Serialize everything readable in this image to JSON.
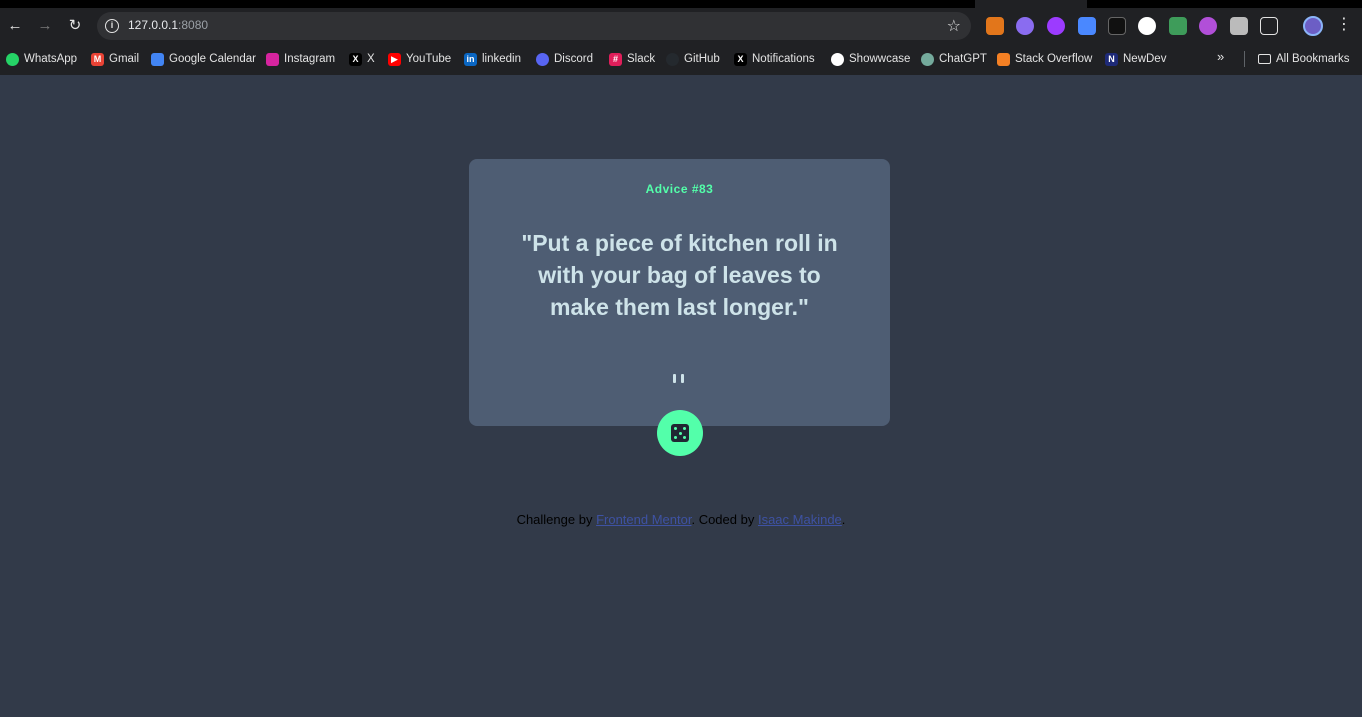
{
  "browser": {
    "url_host": "127.0.0.1",
    "url_port": ":8080",
    "bookmarks": [
      {
        "label": "WhatsApp",
        "icon": "whatsapp-icon",
        "color": "#25d366"
      },
      {
        "label": "Gmail",
        "icon": "gmail-icon",
        "color": "#ea4335"
      },
      {
        "label": "Google Calendar",
        "icon": "calendar-icon",
        "color": "#4285f4"
      },
      {
        "label": "Instagram",
        "icon": "instagram-icon",
        "color": "#d6249f"
      },
      {
        "label": "X",
        "icon": "x-icon",
        "color": "#000000"
      },
      {
        "label": "YouTube",
        "icon": "youtube-icon",
        "color": "#ff0000"
      },
      {
        "label": "linkedin",
        "icon": "linkedin-icon",
        "color": "#0a66c2"
      },
      {
        "label": "Discord",
        "icon": "discord-icon",
        "color": "#5865f2"
      },
      {
        "label": "Slack",
        "icon": "slack-icon",
        "color": "#e01e5a"
      },
      {
        "label": "GitHub",
        "icon": "github-icon",
        "color": "#24292e"
      },
      {
        "label": "Notifications",
        "icon": "x-icon",
        "color": "#000000"
      },
      {
        "label": "Showwcase",
        "icon": "showwcase-icon",
        "color": "#ffffff"
      },
      {
        "label": "ChatGPT",
        "icon": "chatgpt-icon",
        "color": "#74aa9c"
      },
      {
        "label": "Stack Overflow",
        "icon": "stackoverflow-icon",
        "color": "#f48024"
      },
      {
        "label": "NewDev",
        "icon": "newdev-icon",
        "color": "#1e2a78"
      }
    ],
    "all_bookmarks_label": "All Bookmarks"
  },
  "advice": {
    "id_label": "Advice #83",
    "text": "\"Put a piece of kitchen roll in with your bag of leaves to make them last longer.\"",
    "accent_color": "#53ffaa"
  },
  "footer": {
    "challenge_by": "Challenge by",
    "fm_link": "Frontend Mentor",
    "coded_by": ". Coded by",
    "author_link": "Isaac Makinde",
    "end": "."
  }
}
